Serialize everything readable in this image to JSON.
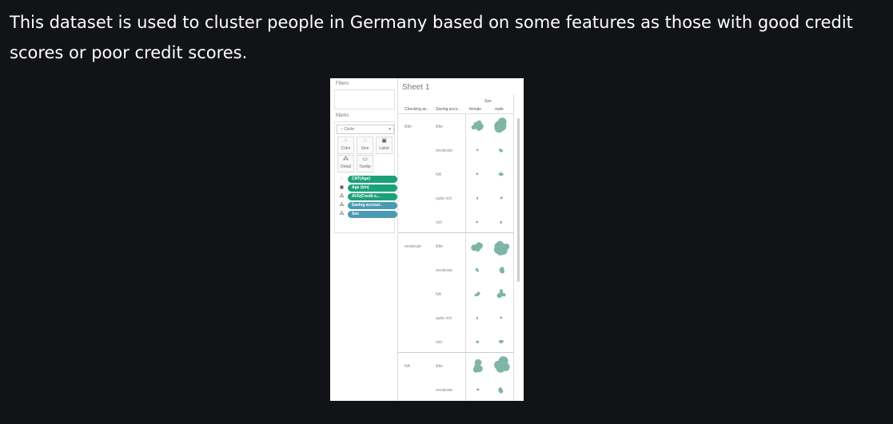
{
  "paragraph": "This dataset is used to cluster people in Germany based on some features as those with good credit scores or poor credit scores.",
  "tableau": {
    "filters_label": "Filters",
    "marks_label": "Marks",
    "mark_type": "Circle",
    "mark_buttons": {
      "color": "Color",
      "size": "Size",
      "label": "Label",
      "detail": "Detail",
      "tooltip": "Tooltip"
    },
    "pills": [
      {
        "label": "CNT(Age)",
        "color": "#1aa179"
      },
      {
        "label": "Age (bin)",
        "color": "#1aa179"
      },
      {
        "label": "AVG(Credit a...",
        "color": "#1aa179"
      },
      {
        "label": "Saving accoun..",
        "color": "#4b9ab3"
      },
      {
        "label": "Sex",
        "color": "#4b9ab3"
      }
    ],
    "sheet_title": "Sheet 1",
    "col_headers": {
      "checking": "Checking ac..",
      "saving": "Saving acco..",
      "sex": "Sex",
      "female": "female",
      "male": "male"
    },
    "groups": [
      {
        "label": "little",
        "rows": [
          "little",
          "moderate",
          "NA",
          "quite rich",
          "rich"
        ]
      },
      {
        "label": "moderate",
        "rows": [
          "little",
          "moderate",
          "NA",
          "quite rich",
          "rich"
        ]
      },
      {
        "label": "NA",
        "rows": [
          "little",
          "moderate"
        ]
      }
    ],
    "bubble_color": "#7fb5a6"
  }
}
